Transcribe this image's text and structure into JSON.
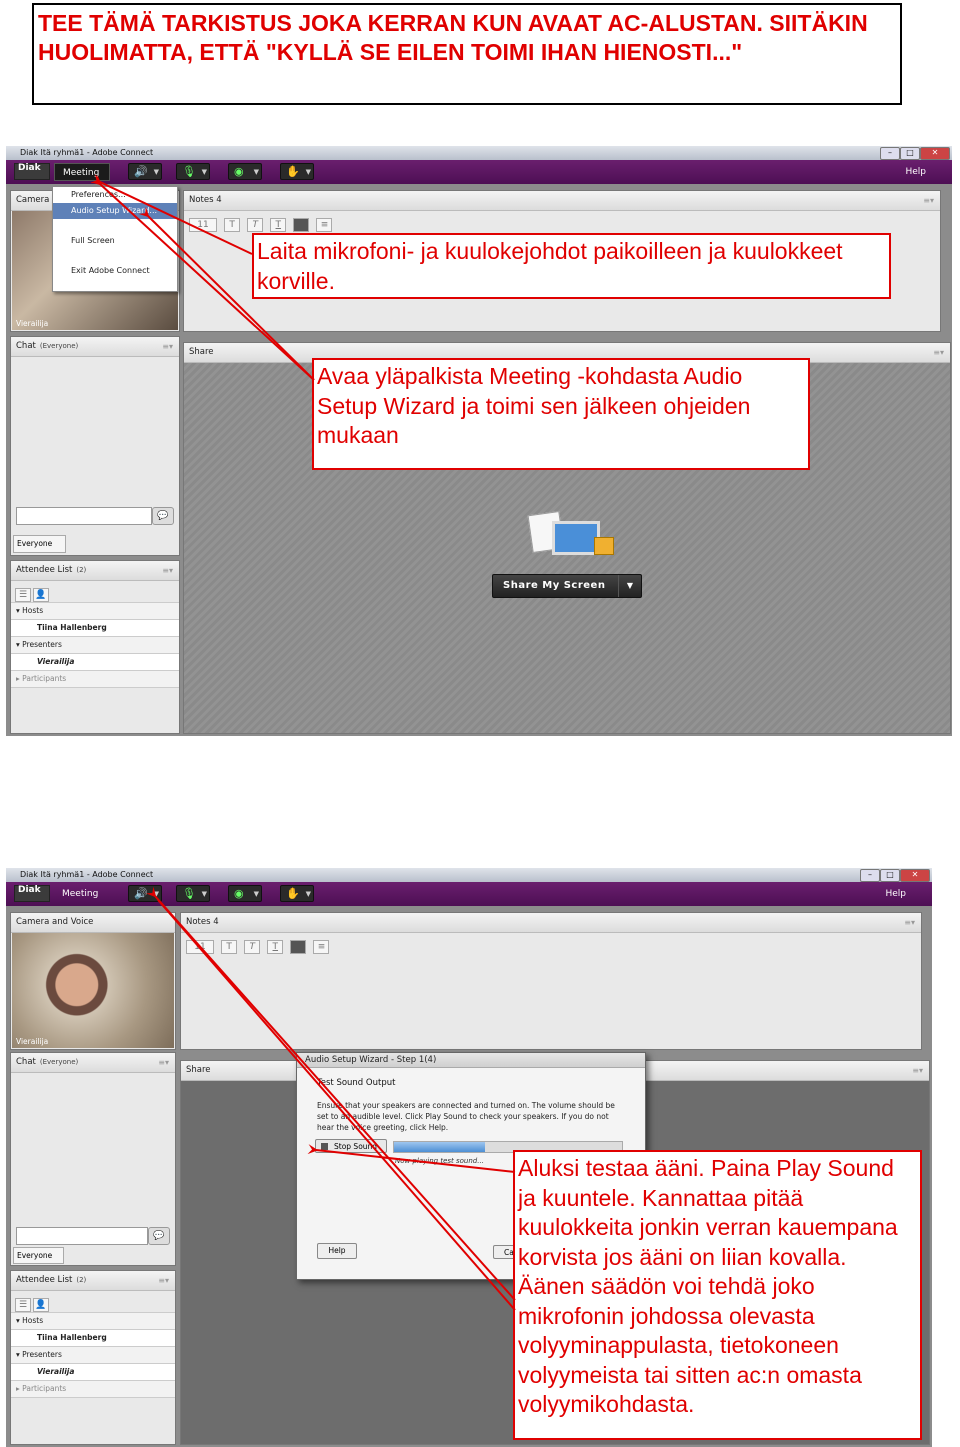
{
  "instruction_header": "TEE TÄMÄ TARKISTUS JOKA KERRAN KUN AVAAT AC-ALUSTAN. SIITÄKIN HUOLIMATTA, ETTÄ \"KYLLÄ SE EILEN TOIMI IHAN HIENOSTI...\"",
  "callouts": {
    "plug_in": "Laita mikrofoni- ja kuulokejohdot paikoilleen ja kuulokkeet korville.",
    "open_wizard": "Avaa yläpalkista Meeting -kohdasta Audio Setup Wizard ja toimi sen jälkeen ohjeiden mukaan",
    "test_sound": "Aluksi testaa ääni. Paina Play Sound ja kuuntele. Kannattaa pitää kuulokkeita jonkin verran kauempana korvista jos ääni on liian kovalla. Äänen säädön voi tehdä joko mikrofonin johdossa olevasta volyyminappulasta, tietokoneen volyymeista tai sitten ac:n omasta volyymikohdasta."
  },
  "window": {
    "title": "Diak Itä ryhmä1 - Adobe Connect",
    "logo": "Diak",
    "meeting_menu": "Meeting",
    "help_menu": "Help"
  },
  "meeting_dropdown": [
    "Preferences...",
    "Audio Setup Wizard...",
    "Full Screen",
    "Exit Adobe Connect"
  ],
  "pods": {
    "camera_short": "Camera",
    "camera_voice": "Camera and Voice",
    "camera_user": "Vierailija",
    "notes": "Notes 4",
    "font_size": "11",
    "chat": "Chat",
    "chat_scope": "(Everyone)",
    "chat_target": "Everyone",
    "share": "Share",
    "share_button": "Share My Screen",
    "attendee": "Attendee List",
    "attendee_count": "(2)"
  },
  "attendees": {
    "hosts": "Hosts",
    "host_name": "Tiina Hallenberg",
    "presenters": "Presenters",
    "presenter_name": "Vierailija",
    "participants": "Participants"
  },
  "wizard": {
    "title": "Audio Setup Wizard - Step 1(4)",
    "heading": "Test Sound Output",
    "body": "Ensure that your speakers are connected and turned on. The volume should be set to an audible level. Click Play Sound to check your speakers. If you do not hear the voice greeting, click Help.",
    "stop_button": "Stop Sound",
    "status": "Now playing test sound...",
    "progress": 0.4,
    "help_button": "Help",
    "cancel_button": "Ca"
  },
  "colors": {
    "annotation_red": "#e00000",
    "menubar_purple": "#5a1660"
  }
}
